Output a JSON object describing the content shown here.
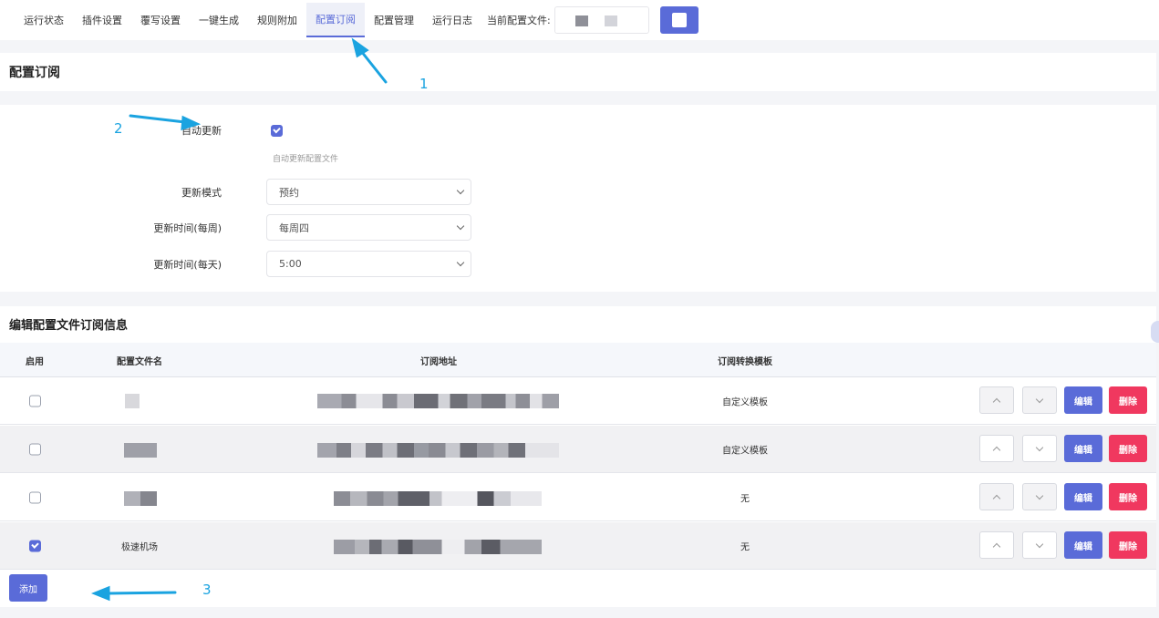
{
  "nav": {
    "tabs": [
      {
        "label": "运行状态"
      },
      {
        "label": "插件设置"
      },
      {
        "label": "覆写设置"
      },
      {
        "label": "一键生成"
      },
      {
        "label": "规则附加"
      },
      {
        "label": "配置订阅",
        "active": true
      },
      {
        "label": "配置管理"
      },
      {
        "label": "运行日志"
      }
    ],
    "current_config_label": "当前配置文件:"
  },
  "subscription": {
    "title": "配置订阅",
    "auto_update_label": "自动更新",
    "auto_update_checked": true,
    "auto_update_hint": "自动更新配置文件",
    "update_mode_label": "更新模式",
    "update_mode_value": "预约",
    "update_week_label": "更新时间(每周)",
    "update_week_value": "每周四",
    "update_day_label": "更新时间(每天)",
    "update_day_value": "5:00"
  },
  "table": {
    "title": "编辑配置文件订阅信息",
    "headers": {
      "enable": "启用",
      "name": "配置文件名",
      "url": "订阅地址",
      "template": "订阅转换模板"
    },
    "rows": [
      {
        "enabled": false,
        "name": "",
        "template": "自定义模板"
      },
      {
        "enabled": false,
        "name": "",
        "template": "自定义模板"
      },
      {
        "enabled": false,
        "name": "",
        "template": "无"
      },
      {
        "enabled": true,
        "name": "极速机场",
        "template": "无"
      }
    ],
    "edit_label": "编辑",
    "delete_label": "删除",
    "add_label": "添加"
  },
  "annotations": {
    "a1": "1",
    "a2": "2",
    "a3": "3"
  },
  "colors": {
    "accent": "#5a6bd8",
    "danger": "#f0385f",
    "annotation": "#1aa3e0"
  }
}
